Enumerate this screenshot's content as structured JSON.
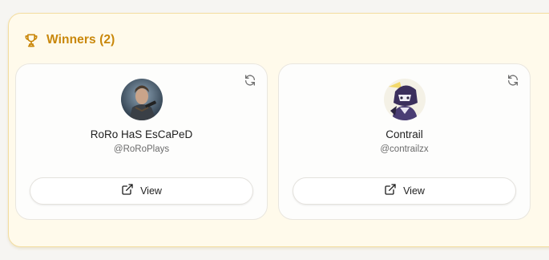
{
  "section": {
    "title": "Winners (2)",
    "accent_color": "#c9870a",
    "icon": "trophy-icon"
  },
  "winners": [
    {
      "display_name": "RoRo HaS EsCaPeD",
      "handle": "@RoRoPlays",
      "view_label": "View",
      "refresh_icon": "refresh-icon",
      "view_icon": "external-link-icon"
    },
    {
      "display_name": "Contrail",
      "handle": "@contrailzx",
      "view_label": "View",
      "refresh_icon": "refresh-icon",
      "view_icon": "external-link-icon"
    }
  ]
}
